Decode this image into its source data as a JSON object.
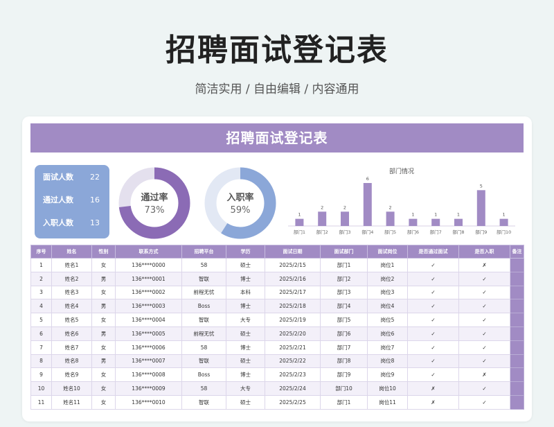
{
  "page": {
    "title": "招聘面试登记表",
    "subtitle": "简洁实用 / 自由编辑 / 内容通用"
  },
  "sheet": {
    "title": "招聘面试登记表"
  },
  "stats": [
    {
      "label": "面试人数",
      "value": "22"
    },
    {
      "label": "通过人数",
      "value": "16"
    },
    {
      "label": "入职人数",
      "value": "13"
    }
  ],
  "donuts": [
    {
      "label": "通过率",
      "value_text": "73%",
      "value": 0.73
    },
    {
      "label": "入职率",
      "value_text": "59%",
      "value": 0.59
    }
  ],
  "colors": {
    "accent": "#a18bc4",
    "donut1": "#8b6bb5",
    "donut2": "#8ba7d8",
    "stats_box": "#8ba7d8"
  },
  "chart_data": {
    "type": "bar",
    "title": "部门情况",
    "categories": [
      "部门1",
      "部门2",
      "部门3",
      "部门4",
      "部门5",
      "部门6",
      "部门7",
      "部门8",
      "部门9",
      "部门10"
    ],
    "values": [
      1,
      2,
      2,
      6,
      2,
      1,
      1,
      1,
      5,
      1
    ],
    "ylim": [
      0,
      6
    ],
    "grid": false
  },
  "table": {
    "headers": [
      "序号",
      "姓名",
      "性别",
      "联系方式",
      "招聘平台",
      "学历",
      "面试日期",
      "面试部门",
      "面试岗位",
      "是否通过面试",
      "是否入职",
      "备注"
    ],
    "rows": [
      [
        "1",
        "姓名1",
        "女",
        "136****0000",
        "58",
        "硕士",
        "2025/2/15",
        "部门1",
        "岗位1",
        "✓",
        "✗",
        ""
      ],
      [
        "2",
        "姓名2",
        "男",
        "136****0001",
        "智联",
        "博士",
        "2025/2/16",
        "部门2",
        "岗位2",
        "✓",
        "✓",
        ""
      ],
      [
        "3",
        "姓名3",
        "女",
        "136****0002",
        "前程无忧",
        "本科",
        "2025/2/17",
        "部门3",
        "岗位3",
        "✓",
        "✓",
        ""
      ],
      [
        "4",
        "姓名4",
        "男",
        "136****0003",
        "Boss",
        "博士",
        "2025/2/18",
        "部门4",
        "岗位4",
        "✓",
        "✓",
        ""
      ],
      [
        "5",
        "姓名5",
        "女",
        "136****0004",
        "智联",
        "大专",
        "2025/2/19",
        "部门5",
        "岗位5",
        "✓",
        "✓",
        ""
      ],
      [
        "6",
        "姓名6",
        "男",
        "136****0005",
        "前程无忧",
        "硕士",
        "2025/2/20",
        "部门6",
        "岗位6",
        "✓",
        "✓",
        ""
      ],
      [
        "7",
        "姓名7",
        "女",
        "136****0006",
        "58",
        "博士",
        "2025/2/21",
        "部门7",
        "岗位7",
        "✓",
        "✓",
        ""
      ],
      [
        "8",
        "姓名8",
        "男",
        "136****0007",
        "智联",
        "硕士",
        "2025/2/22",
        "部门8",
        "岗位8",
        "✓",
        "✓",
        ""
      ],
      [
        "9",
        "姓名9",
        "女",
        "136****0008",
        "Boss",
        "博士",
        "2025/2/23",
        "部门9",
        "岗位9",
        "✓",
        "✗",
        ""
      ],
      [
        "10",
        "姓名10",
        "女",
        "136****0009",
        "58",
        "大专",
        "2025/2/24",
        "部门10",
        "岗位10",
        "✗",
        "✓",
        ""
      ],
      [
        "11",
        "姓名11",
        "女",
        "136****0010",
        "智联",
        "硕士",
        "2025/2/25",
        "部门1",
        "岗位11",
        "✗",
        "✓",
        ""
      ]
    ]
  }
}
